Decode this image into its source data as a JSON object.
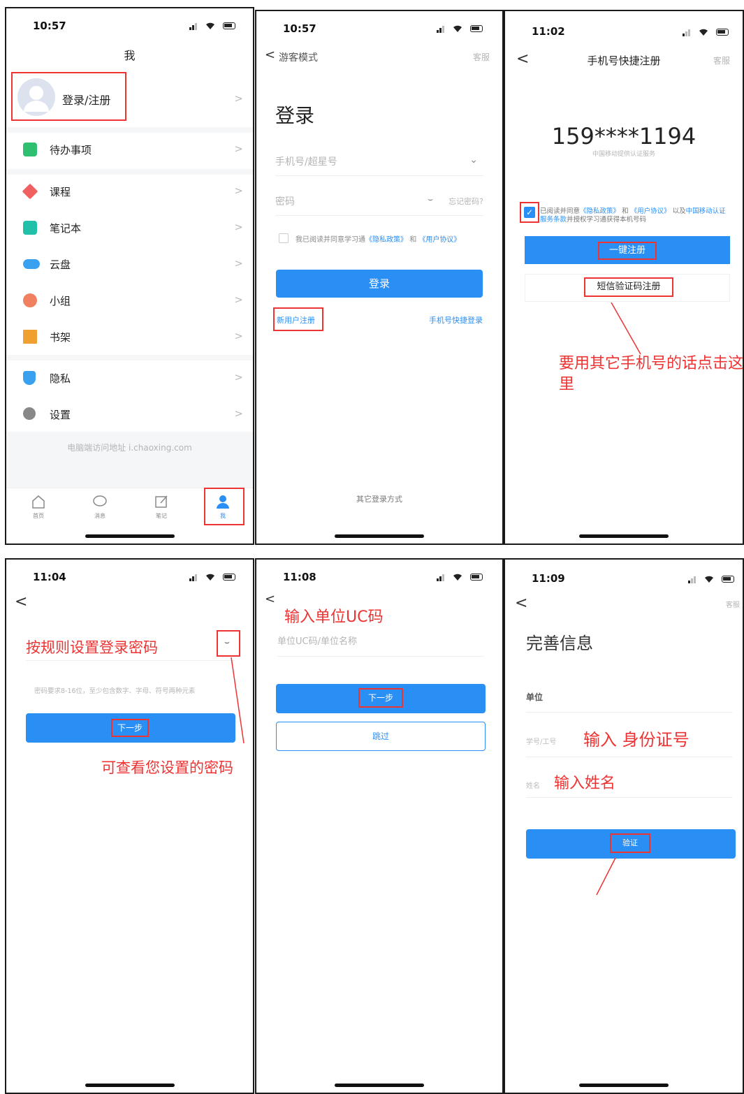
{
  "colors": {
    "accent": "#2a8ff5",
    "annotation": "#e33333"
  },
  "panel1": {
    "time": "10:57",
    "title": "我",
    "login_label": "登录/注册",
    "menu": [
      {
        "label": "待办事项",
        "icon": "todo-icon",
        "color": "#2fbf71"
      },
      {
        "label": "课程",
        "icon": "course-icon",
        "color": "#f06060"
      },
      {
        "label": "笔记本",
        "icon": "notebook-icon",
        "color": "#22c0a8"
      },
      {
        "label": "云盘",
        "icon": "cloud-icon",
        "color": "#3aa0f0"
      },
      {
        "label": "小组",
        "icon": "group-icon",
        "color": "#f08060"
      },
      {
        "label": "书架",
        "icon": "bookshelf-icon",
        "color": "#f0a030"
      },
      {
        "label": "隐私",
        "icon": "privacy-icon",
        "color": "#3aa0f0"
      },
      {
        "label": "设置",
        "icon": "settings-icon",
        "color": "#888888"
      }
    ],
    "footer": "电脑端访问地址 i.chaoxing.com",
    "tabs": [
      {
        "label": "首页",
        "icon": "home-icon"
      },
      {
        "label": "消息",
        "icon": "message-icon"
      },
      {
        "label": "笔记",
        "icon": "note-icon"
      },
      {
        "label": "我",
        "icon": "user-icon"
      }
    ]
  },
  "panel2": {
    "time": "10:57",
    "back_label": "游客模式",
    "service": "客服",
    "heading": "登录",
    "phone_placeholder": "手机号/超星号",
    "password_placeholder": "密码",
    "forgot": "忘记密码?",
    "agree_prefix": "我已阅读并同意学习通",
    "privacy": "《隐私政策》",
    "and": "和",
    "agreement": "《用户协议》",
    "login_button": "登录",
    "register_link": "新用户注册",
    "quick_login": "手机号快捷登录",
    "other_login": "其它登录方式"
  },
  "panel3": {
    "time": "11:02",
    "title": "手机号快捷注册",
    "service": "客服",
    "phone_masked": "159****1194",
    "provider": "中国移动提供认证服务",
    "agree_text_1": "已阅读并同意",
    "privacy": "《隐私政策》",
    "and": "和",
    "agreement": "《用户协议》",
    "agree_text_2": "以及",
    "cmcc_terms": "中国移动认证服务条款",
    "agree_text_3": "并授权学习通获得本机号码",
    "one_click_button": "一键注册",
    "sms_button": "短信验证码注册",
    "annotation": "要用其它手机号的话点击这里"
  },
  "panel4": {
    "time": "11:04",
    "annotation_title": "按规则设置登录密码",
    "hint": "密码要求8-16位，至少包含数字、字母、符号两种元素",
    "next_button": "下一步",
    "annotation_eye": "可查看您设置的密码"
  },
  "panel5": {
    "time": "11:08",
    "annotation_title": "输入单位UC码",
    "uc_placeholder": "单位UC码/单位名称",
    "next_button": "下一步",
    "skip_button": "跳过"
  },
  "panel6": {
    "time": "11:09",
    "service": "客服",
    "heading": "完善信息",
    "unit_label": "单位",
    "id_label": "学号/工号",
    "id_annotation": "输入 身份证号",
    "name_label": "姓名",
    "name_annotation": "输入姓名",
    "verify_button": "验证"
  }
}
